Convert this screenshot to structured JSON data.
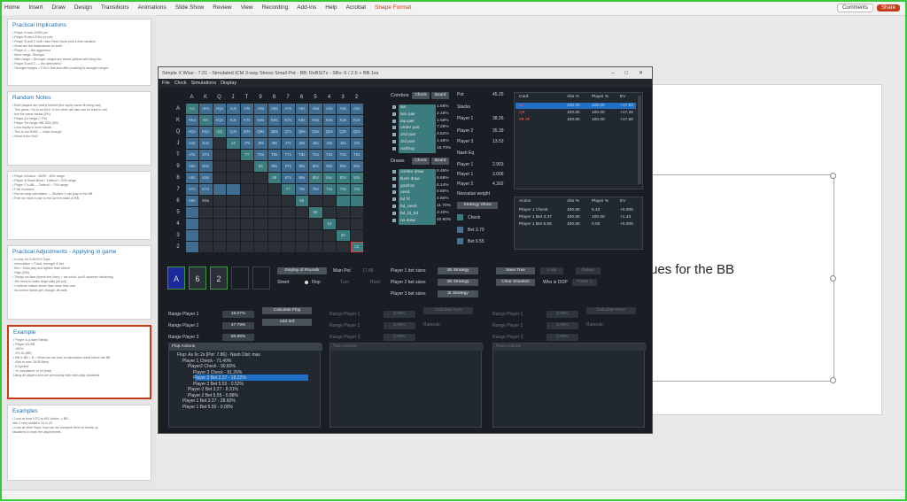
{
  "ribbon": {
    "tabs": [
      "Home",
      "Insert",
      "Draw",
      "Design",
      "Transitions",
      "Animations",
      "Slide Show",
      "Review",
      "View",
      "Recording",
      "Add-ins",
      "Help",
      "Acrobat",
      "Shape Format"
    ],
    "comments": "Comments",
    "share": "Share"
  },
  "slides": [
    {
      "title": "Practical Implications",
      "lines": [
        "• Player A wins 50/50 pot",
        "• Player B wins 2/3rd (of pot)",
        "• Player B and C both raise Real Cards pick in this situation",
        "",
        "• What are the implications for both",
        "• Player A — the aggressor",
        "  ◦ More range: Stronger",
        "  ◦ With range = Stronger ranges are whole (strikes will bring into",
        "• Player B and C — the defenders?",
        "  ◦ Stronger ranges = FOLD first and often pushing to stronger ranges"
      ]
    },
    {
      "title": "Random Notes",
      "lines": [
        "• Both players are nearly behind (the equity same fit being low)",
        "  ◦ This gives: 'Go to an All in' & the other will also can be hard to call",
        "  ◦ Are the same hands (5%)",
        "  ◦ Player A's range (~7%)",
        "  ◦ Player B's range: BB 33% (5%)",
        "  ◦ Less equity in more hands",
        "  ◦ This is not 50/50 — close enough",
        "",
        "• What is the 2nd?"
      ]
    },
    {
      "title": "",
      "lines": [
        "• Player A Action - 50/50 - 60% range",
        "• Player B Small Blind + Defend = 20% range",
        "• Player C's BB — Defend = 70% range",
        "",
        "• Fold Incentive",
        "• Not an easy calculation — Student 1 can play in the BB",
        "• Feel we have a pair to the current stack of BB"
      ]
    },
    {
      "title": "Practical Adjustments - Applying in game",
      "lines": [
        "• In play for ICM/CEV flops",
        "  ◦ Information = Folds, stronger & bet",
        "  ◦ Bet = Must play and tighten than others",
        "  ◦ High (200)",
        "",
        "• Things we face (some fine lines) = we could, you'll squeeze hardening",
        "  ◦ Yes need to make large calls (all pot)",
        "  ◦ Continue makes sense than more than one",
        "  ◦ As loosen bands get, though, all calls"
      ]
    },
    {
      "title": "Example",
      "lines": [
        "• Player A (Lower Blinds)",
        "• Player B's BB",
        "  ◦ 100%",
        "  ◦ 0% 45 (BB)",
        "• BB in BB = B = What can we look at calculation result below the BB",
        "  ◦ (Bet to over 35/39 Bets)",
        "  ◦ A Symbol",
        "  ◦ 'A: calculation' to hit (fold)",
        "",
        "  Using all players who are previously with each play situations"
      ]
    },
    {
      "title": "Examples",
      "lines": [
        "• Look at from UTG to MG button -> BB",
        "  with 2 very similar's 10 in 20",
        "",
        "• Look at other flops, how can we compare them to heads-up",
        "  situations to learn the adjustments"
      ]
    }
  ],
  "slide_main_text": "ues for the BB",
  "solver": {
    "title": "Simple X Wise - 7.01 - Simulated ICM 3-way Stress Small Pot - BB: RxBS/7x - SBv: 6 / 2.5 + BB.1xs",
    "menu": [
      "File",
      "Clock",
      "Simulations",
      "Display"
    ],
    "ranks": [
      "A",
      "K",
      "Q",
      "J",
      "T",
      "9",
      "8",
      "7",
      "6",
      "5",
      "4",
      "3",
      "2"
    ],
    "combos_tabs": [
      "Combos",
      "Check",
      "Board"
    ],
    "combos": [
      {
        "name": "set",
        "pct": "1.88%"
      },
      {
        "name": "two pair",
        "pct": "2.18%"
      },
      {
        "name": "top pair",
        "pct": "1.58%"
      },
      {
        "name": "under pair",
        "pct": "7.25%"
      },
      {
        "name": "2nd pair",
        "pct": "3.62%"
      },
      {
        "name": "3rd pair",
        "pct": "1.48%"
      },
      {
        "name": "nothing",
        "pct": "18.70%"
      }
    ],
    "draws_tabs": [
      "Draws",
      "Check",
      "Board"
    ],
    "draws": [
      {
        "name": "combo draw",
        "pct": "0.45%"
      },
      {
        "name": "flush draw",
        "pct": "5.68%"
      },
      {
        "name": "gutshot",
        "pct": "6.14%"
      },
      {
        "name": "oesd",
        "pct": "0.50%"
      },
      {
        "name": "bd fd",
        "pct": "4.60%"
      },
      {
        "name": "bd_oesd",
        "pct": "11.70%"
      },
      {
        "name": "bd_fd_bd",
        "pct": "3.10%"
      },
      {
        "name": "no draw",
        "pct": "40.90%"
      }
    ],
    "pot": {
      "pot_label": "Pot",
      "pot_value": "45.25",
      "stacks": "Stacks",
      "p1": "Player 1",
      "p1v": "38.26",
      "p2": "Player 2",
      "p2v": "35.39",
      "p3": "Player 3",
      "p3v": "13.53",
      "hero": "Nash Eq",
      "eq_title": "Player 1",
      "eq1": "2.903",
      "eq2": "3.006",
      "eq3": "4.302",
      "strategy": "Strategy Show",
      "check": "Check",
      "bet1": "Bet 3.79",
      "bet2": "Bet 6.55",
      "node": "Nonvalue weight"
    },
    "top_table": {
      "headers": [
        "Card",
        "Abs %",
        "Player %",
        "EV"
      ],
      "rows": [
        [
          "♠J",
          "100.00",
          "100.00",
          "+17.93"
        ],
        [
          "Q♥",
          "100.00",
          "100.00",
          "+17.20"
        ],
        [
          "9♥ J♥",
          "100.00",
          "100.00",
          "+17.50"
        ]
      ]
    },
    "action_table": {
      "headers": [
        "Action",
        "Abs %",
        "Player %",
        "EV"
      ],
      "rows": [
        [
          "Player 1 Check",
          "100.00",
          "6.43",
          "+0.000"
        ],
        [
          "Player 1 Bet 3.37",
          "100.00",
          "100.00",
          "+1.43"
        ],
        [
          "Player 1 Bet 5.55",
          "100.00",
          "0.00",
          "+0.000"
        ]
      ]
    },
    "board_cards": [
      "A",
      "6",
      "2"
    ],
    "controls": {
      "display": "Display of Rounds",
      "main_pot": "Main Pot",
      "main_pot_v": "17.86",
      "street": "Street",
      "flop": "Flop",
      "turn": "Turn",
      "river": "River",
      "p1_bet": "Player 1 bet sizes",
      "p2_bet": "Player 2 bet sizes",
      "p3_bet": "Player 3 bet sizes",
      "strat1": "3B Strategy",
      "strat2": "3B Strategy",
      "strat3": "3r Strategy",
      "save": "Save Tree",
      "load": "Load",
      "delete": "Delete",
      "clear": "Clear Situation",
      "who": "Who is OOP",
      "who_v": "Player 1"
    },
    "ranges": {
      "r1": "Range Player 1",
      "r1v": "15.07%",
      "r2": "Range Player 2",
      "r2v": "47.79%",
      "r3": "Range Player 3",
      "r3v": "66.86%",
      "calc": "Calculate Flop",
      "add": "Add 3rd",
      "dim_r1": "Range Player 1",
      "dim_r2": "Range Player 2",
      "dim_r3": "Range Player 3",
      "dim_v": "0.00%",
      "calc_turn": "Calculate Turn",
      "calc_river": "Calculate River",
      "runouts": "Runouts"
    },
    "tree": {
      "header": "Flop Actions",
      "header2": "Turn Actions",
      "header3": "River Actions",
      "nodes": [
        "Flop: As 6c 2s [Pot: 7.86] - Nash Dist: max",
        "Player 1 Check - 71.40%",
        "Player2 Check - 90.80%",
        "Player 3 Check - 81.26%",
        "Player 3 Bet 2.37 - 18.22%",
        "Player 3 Bet 5.55 - 0.52%",
        "Player 2 Bet 3.27 - 8.31%",
        "Player 2 Bet 5.55 - 0.88%",
        "Player 1 Bet 3.37 - 28.60%",
        "Player 1 Bet 5.55 - 0.00%"
      ]
    }
  }
}
